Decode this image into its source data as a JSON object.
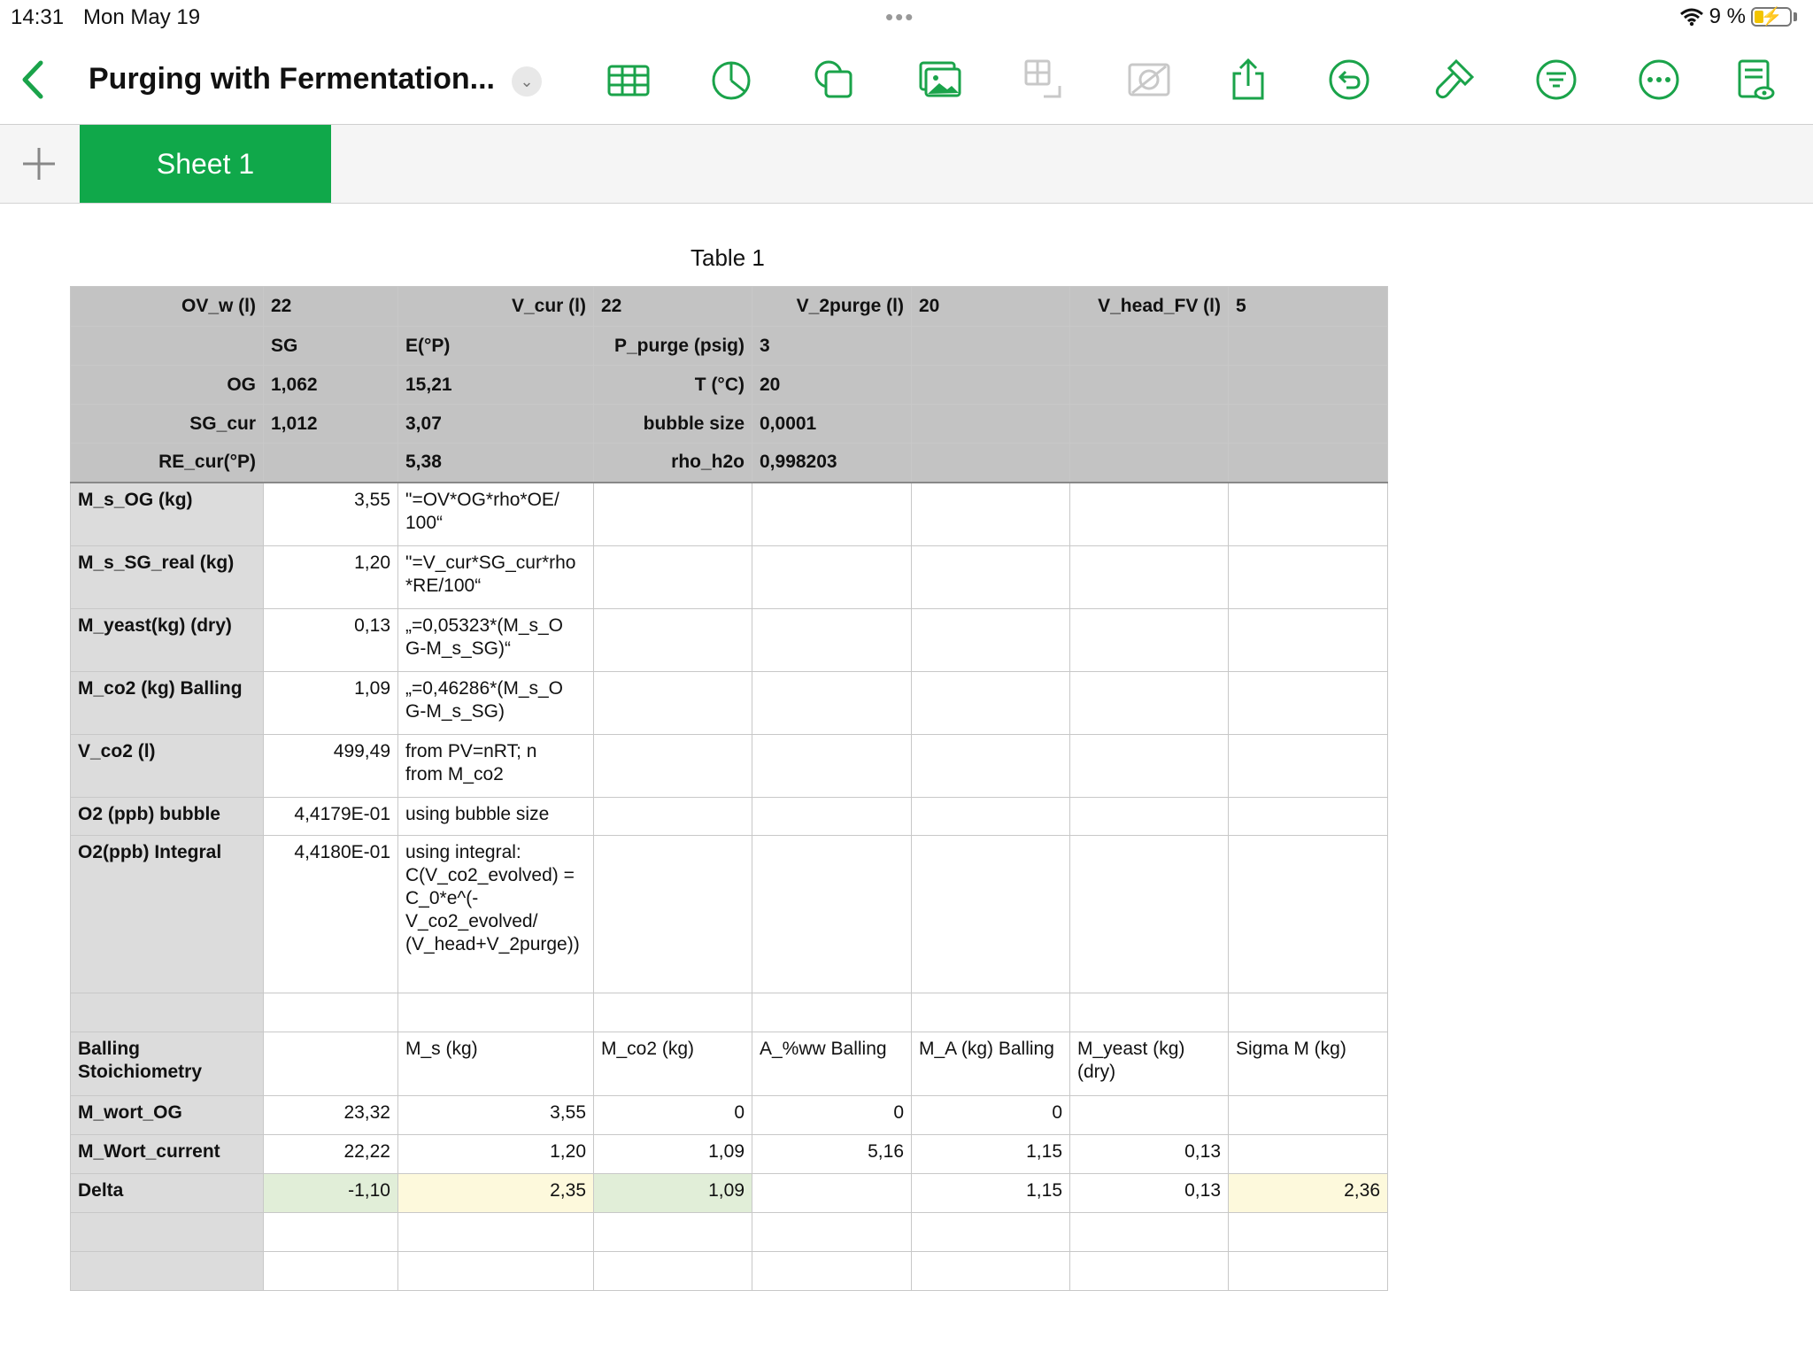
{
  "status_bar": {
    "time": "14:31",
    "date": "Mon May 19",
    "battery": "9 %",
    "battery_level": 0.09
  },
  "toolbar": {
    "title": "Purging with Fermentation...",
    "accent_color": "#1aa34a",
    "icons": [
      "back-icon",
      "table-icon",
      "chart-icon",
      "shape-icon",
      "media-icon",
      "table-move-icon",
      "image-placeholder-icon",
      "share-icon",
      "undo-icon",
      "format-brush-icon",
      "filter-icon",
      "more-icon",
      "reading-view-icon"
    ]
  },
  "tabs": {
    "sheet1": "Sheet 1",
    "tab_color": "#10a84a"
  },
  "table": {
    "title": "Table 1",
    "rows": [
      [
        "OV_w (l)",
        "22",
        "",
        "V_cur (l)",
        "22",
        "V_2purge (l)",
        "20",
        "V_head_FV (l)",
        "5"
      ],
      [
        "",
        "SG",
        "E(°P)",
        "P_purge (psig)",
        "3",
        "",
        "",
        "",
        ""
      ],
      [
        "OG",
        "1,062",
        "15,21",
        "T (°C)",
        "20",
        "",
        "",
        "",
        ""
      ],
      [
        "SG_cur",
        "1,012",
        "3,07",
        "bubble size",
        "0,0001",
        "",
        "",
        "",
        ""
      ],
      [
        "RE_cur(°P)",
        "",
        "5,38",
        "rho_h2o",
        "0,998203",
        "",
        "",
        "",
        ""
      ],
      [
        "M_s_OG (kg)",
        "3,55",
        "\"=OV*OG*rho*OE/\n100“",
        "",
        "",
        "",
        "",
        ""
      ],
      [
        "M_s_SG_real (kg)",
        "1,20",
        "\"=V_cur*SG_cur*rho\n*RE/100“",
        "",
        "",
        "",
        "",
        ""
      ],
      [
        "M_yeast(kg) (dry)",
        "0,13",
        "„=0,05323*(M_s_O\nG-M_s_SG)“",
        "",
        "",
        "",
        "",
        ""
      ],
      [
        "M_co2 (kg) Balling",
        "1,09",
        "„=0,46286*(M_s_O\nG-M_s_SG)",
        "",
        "",
        "",
        "",
        ""
      ],
      [
        "V_co2 (l)",
        "499,49",
        "from PV=nRT; n\nfrom M_co2",
        "",
        "",
        "",
        "",
        ""
      ],
      [
        "O2 (ppb) bubble",
        "4,4179E-01",
        "using bubble size",
        "",
        "",
        "",
        "",
        ""
      ],
      [
        "O2(ppb) Integral",
        "4,4180E-01",
        "using integral:\nC(V_co2_evolved) =\nC_0*e^(-\nV_co2_evolved/\n(V_head+V_2purge))",
        "",
        "",
        "",
        "",
        ""
      ],
      [
        "",
        "",
        "",
        "",
        "",
        "",
        "",
        ""
      ],
      [
        "Balling\nStoichiometry",
        "",
        "M_s (kg)",
        "M_co2 (kg)",
        "A_%ww Balling",
        "M_A (kg) Balling",
        "M_yeast (kg)\n(dry)",
        "Sigma M (kg)"
      ],
      [
        "M_wort_OG",
        "23,32",
        "3,55",
        "0",
        "0",
        "0",
        "",
        ""
      ],
      [
        "M_Wort_current",
        "22,22",
        "1,20",
        "1,09",
        "5,16",
        "1,15",
        "0,13",
        ""
      ],
      [
        "Delta",
        "-1,10",
        "2,35",
        "1,09",
        "",
        "1,15",
        "0,13",
        "2,36"
      ],
      [
        "",
        "",
        "",
        "",
        "",
        "",
        "",
        ""
      ],
      [
        "",
        "",
        "",
        "",
        "",
        "",
        "",
        ""
      ]
    ],
    "highlight_green": "#e1eed8",
    "highlight_yellow": "#fdf9dc"
  }
}
